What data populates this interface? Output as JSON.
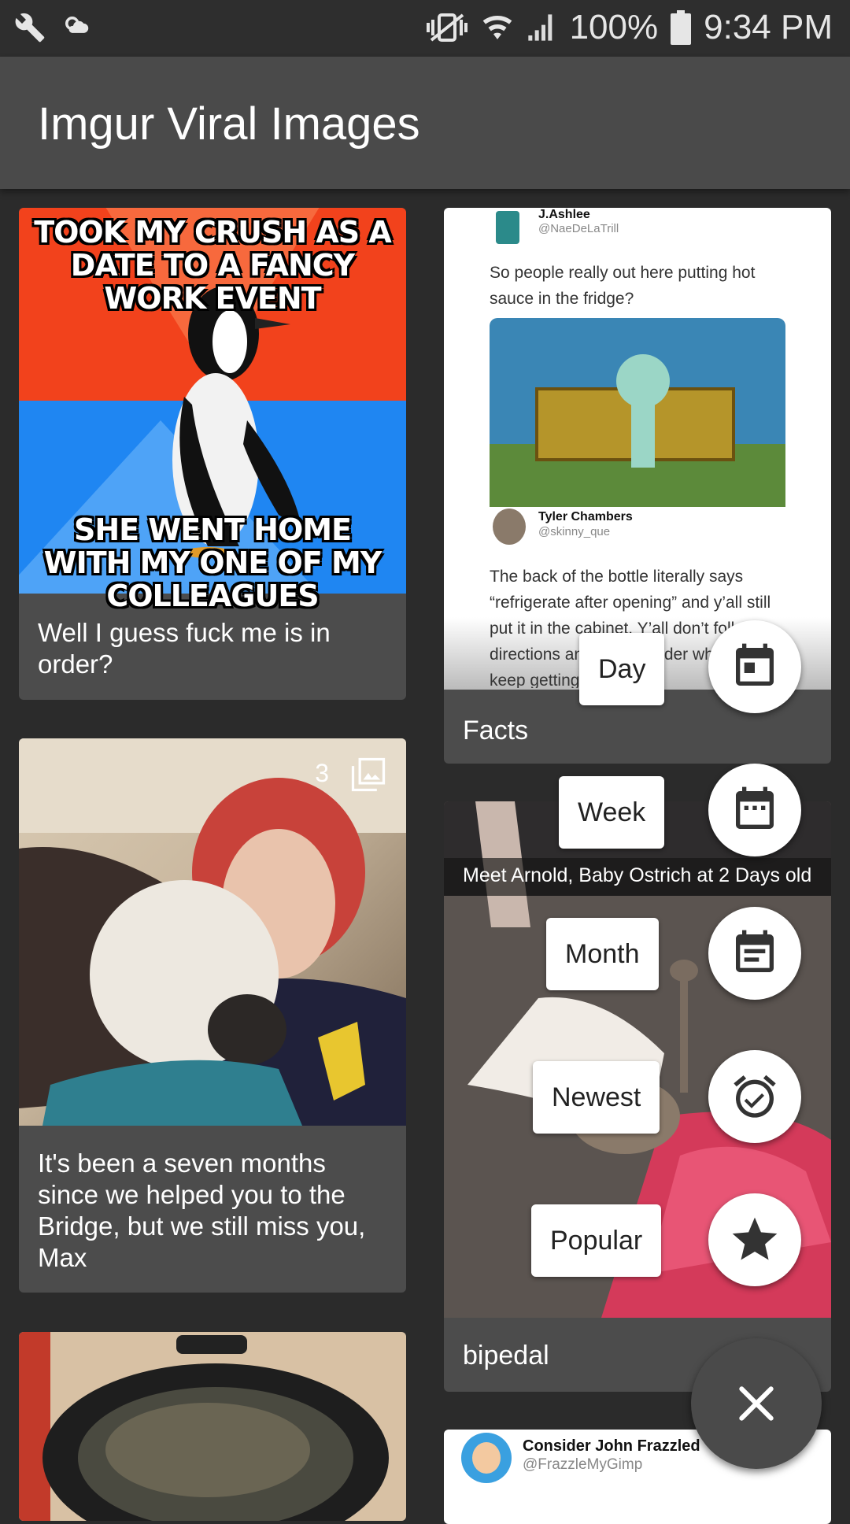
{
  "status_bar": {
    "battery_text": "100%",
    "time": "9:34 PM",
    "icons": [
      "wrench-icon",
      "weather-icon",
      "vibrate-icon",
      "wifi-icon",
      "signal-icon",
      "battery-icon"
    ]
  },
  "app_bar": {
    "title": "Imgur Viral Images"
  },
  "cards": [
    {
      "caption": "Well I guess fuck me is in order?",
      "meme_top": "TOOK MY CRUSH AS A DATE TO A FANCY WORK EVENT",
      "meme_bottom": "SHE WENT HOME WITH MY ONE OF MY COLLEAGUES"
    },
    {
      "caption": "It's been a seven months since we helped you to the Bridge, but we still miss you, Max",
      "album_count": "3"
    },
    {
      "caption": "Facts",
      "tweet_name_1": "J.Ashlee",
      "tweet_handle_1": "@NaeDeLaTrill",
      "tweet_text_1": "So people really out here putting hot sauce in the fridge?",
      "tweet_name_2": "Tyler Chambers",
      "tweet_handle_2": "@skinny_que",
      "tweet_text_2": "The back of the bottle literally says “refrigerate after opening” and y’all still put it in the cabinet. Y’all don’t follow directions and then wonder why y’all keep getting pregnant"
    },
    {
      "caption": "bipedal",
      "overlay_title": "Meet Arnold, Baby Ostrich at 2 Days old"
    },
    {
      "tweet_name": "Consider John Frazzled",
      "tweet_handle": "@FrazzleMyGimp"
    }
  ],
  "fab_menu": {
    "items": [
      {
        "label": "Day",
        "icon": "calendar-day-icon"
      },
      {
        "label": "Week",
        "icon": "calendar-week-icon"
      },
      {
        "label": "Month",
        "icon": "calendar-month-icon"
      },
      {
        "label": "Newest",
        "icon": "alarm-check-icon"
      },
      {
        "label": "Popular",
        "icon": "star-icon"
      }
    ],
    "close_icon": "close-icon"
  }
}
